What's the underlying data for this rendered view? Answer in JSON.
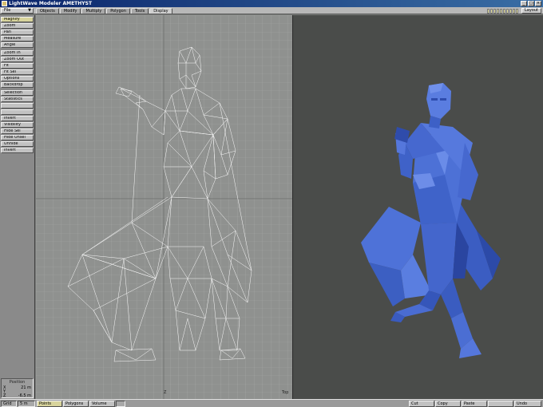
{
  "window": {
    "title": "LightWave Modeler AMETHYST"
  },
  "menu": {
    "file_label": "File",
    "layout_label": "Layout"
  },
  "tabs": [
    {
      "label": "Objects"
    },
    {
      "label": "Modify"
    },
    {
      "label": "Multiply"
    },
    {
      "label": "Polygon"
    },
    {
      "label": "Tools"
    },
    {
      "label": "Display",
      "active": true
    }
  ],
  "tools": [
    {
      "label": "Magnify"
    },
    {
      "label": "Zoom"
    },
    {
      "label": "Pan"
    },
    {
      "label": "Measure"
    },
    {
      "label": "Angle"
    },
    {
      "label": "Zoom In"
    },
    {
      "label": "Zoom Out"
    },
    {
      "label": "Fit"
    },
    {
      "label": "Fit Sel"
    },
    {
      "label": "Options"
    },
    {
      "label": "Backdrop"
    },
    {
      "label": "Selection"
    },
    {
      "label": "Statistics"
    },
    {
      "label": ""
    },
    {
      "label": ""
    },
    {
      "label": "Invert"
    },
    {
      "label": "Visibility"
    },
    {
      "label": "Hide Sel"
    },
    {
      "label": "Hide Unsel"
    },
    {
      "label": "Unhide"
    },
    {
      "label": "Invert"
    }
  ],
  "position": {
    "header": "Position",
    "x_label": "X",
    "x_value": "21 m",
    "y_label": "Y",
    "y_value": "",
    "z_label": "Z",
    "z_value": "-6.5 m"
  },
  "viewport_left": {
    "axis_label": "Z",
    "corner_label": "Top"
  },
  "status": {
    "grid_label": "Grid",
    "grid_value": "5 m",
    "modes": [
      {
        "label": "Points",
        "active": true
      },
      {
        "label": "Polygons"
      },
      {
        "label": "Volume"
      }
    ],
    "layer_label": "",
    "actions": [
      {
        "label": "Cut"
      },
      {
        "label": "Copy"
      },
      {
        "label": "Paste"
      },
      {
        "label": ""
      },
      {
        "label": "Undo"
      }
    ]
  },
  "colors": {
    "model_fill": "#4a6fd6",
    "wireframe": "#ffffff",
    "grid": "#a5a7a5",
    "title_bar": "#0a246a"
  }
}
